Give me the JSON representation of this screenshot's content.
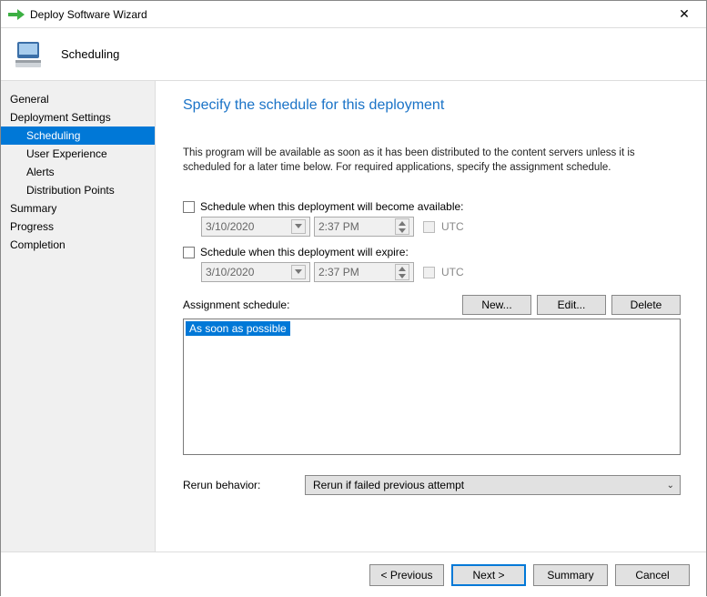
{
  "window": {
    "title": "Deploy Software Wizard"
  },
  "header": {
    "step_name": "Scheduling"
  },
  "sidebar": {
    "items": [
      {
        "label": "General",
        "sub": false,
        "selected": false
      },
      {
        "label": "Deployment Settings",
        "sub": false,
        "selected": false
      },
      {
        "label": "Scheduling",
        "sub": true,
        "selected": true
      },
      {
        "label": "User Experience",
        "sub": true,
        "selected": false
      },
      {
        "label": "Alerts",
        "sub": true,
        "selected": false
      },
      {
        "label": "Distribution Points",
        "sub": true,
        "selected": false
      },
      {
        "label": "Summary",
        "sub": false,
        "selected": false
      },
      {
        "label": "Progress",
        "sub": false,
        "selected": false
      },
      {
        "label": "Completion",
        "sub": false,
        "selected": false
      }
    ]
  },
  "main": {
    "title": "Specify the schedule for this deployment",
    "intro": "This program will be available as soon as it has been distributed to the content servers unless it is scheduled for a later time below. For required applications, specify the assignment schedule.",
    "schedule_available_label": "Schedule when this deployment will become available:",
    "schedule_expire_label": "Schedule when this deployment will expire:",
    "date_value": "3/10/2020",
    "time_value": "2:37 PM",
    "utc_label": "UTC",
    "assignment_label": "Assignment schedule:",
    "buttons": {
      "new": "New...",
      "edit": "Edit...",
      "delete": "Delete"
    },
    "list_items": [
      "As soon as possible"
    ],
    "rerun_label": "Rerun behavior:",
    "rerun_value": "Rerun if failed previous attempt"
  },
  "footer": {
    "previous": "< Previous",
    "next": "Next >",
    "summary": "Summary",
    "cancel": "Cancel"
  }
}
